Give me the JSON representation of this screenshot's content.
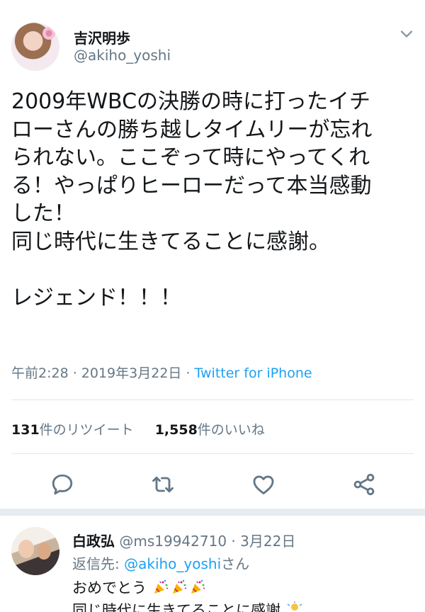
{
  "tweet": {
    "display_name": "吉沢明歩",
    "handle": "@akiho_yoshi",
    "body": "2009年WBCの決勝の時に打ったイチ\nローさんの勝ち越しタイムリーが忘れ\nられない。ここぞって時にやってくれ\nる！やっぱりヒーローだって本当感動\nした！\n同じ時代に生きてることに感謝。\n\nレジェンド！！！",
    "time": "午前2:28",
    "dot": " · ",
    "date": "2019年3月22日",
    "source": "Twitter for iPhone",
    "retweet_count": "131",
    "retweet_label": "件のリツイート",
    "like_count": "1,558",
    "like_label": "件のいいね"
  },
  "actions": [
    "reply-icon",
    "retweet-icon",
    "like-icon",
    "share-icon"
  ],
  "reply": {
    "display_name": "白政弘",
    "handle": "@ms19942710",
    "dot": " · ",
    "date": "3月22日",
    "reply_prefix": "返信先: ",
    "reply_mention": "@akiho_yoshi",
    "reply_suffix": "さん",
    "line1": "おめでとう",
    "line2": "同じ時代に生きてることに感謝"
  },
  "colors": {
    "text": "#14171a",
    "secondary": "#657786",
    "accent": "#1da1f2",
    "divider": "#e1e8ed"
  }
}
